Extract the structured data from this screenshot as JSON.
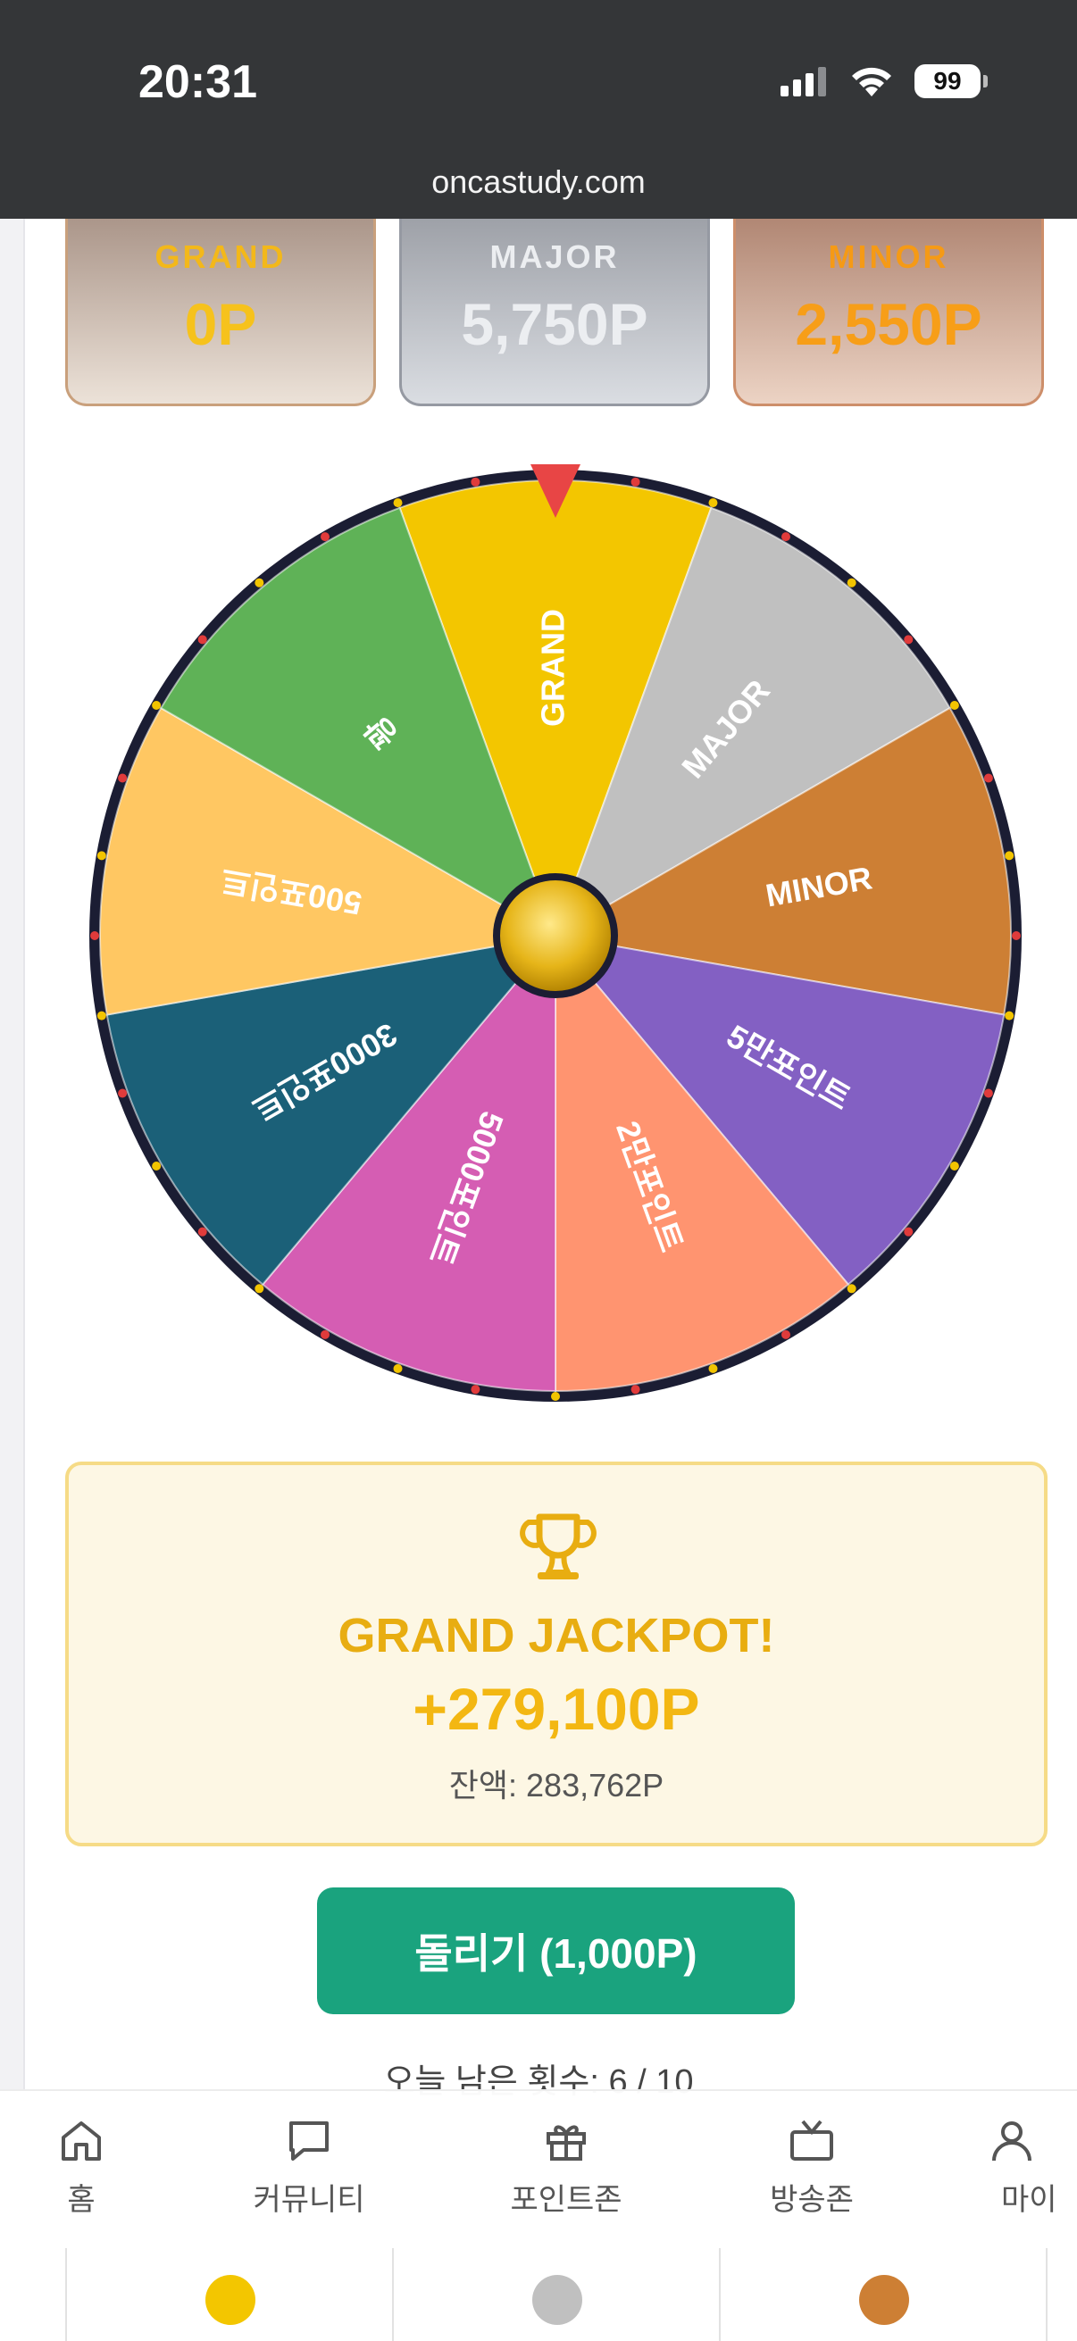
{
  "status_bar": {
    "time": "20:31",
    "battery": "99",
    "url": "oncastudy.com"
  },
  "jackpots": [
    {
      "label": "GRAND",
      "value": "0P",
      "label_color": "#f3b81a",
      "value_color": "#f6c21c"
    },
    {
      "label": "MAJOR",
      "value": "5,750P",
      "label_color": "#eceef1",
      "value_color": "#eceef1"
    },
    {
      "label": "MINOR",
      "value": "2,550P",
      "label_color": "#f59a16",
      "value_color": "#f79e18"
    }
  ],
  "wheel": {
    "segments": [
      {
        "label": "GRAND",
        "color": "#f3c600"
      },
      {
        "label": "MAJOR",
        "color": "#c0c0c0"
      },
      {
        "label": "MINOR",
        "color": "#cd7f34"
      },
      {
        "label": "5만포인트",
        "color": "#8360c3"
      },
      {
        "label": "2만포인트",
        "color": "#ff9470"
      },
      {
        "label": "5000포인트",
        "color": "#d55db3"
      },
      {
        "label": "3000포인트",
        "color": "#1b6078"
      },
      {
        "label": "500포인트",
        "color": "#ffc762"
      },
      {
        "label": "꽝",
        "color": "#5fb257"
      }
    ],
    "rim_color": "#1b1d33",
    "hub_color": "#e6b519",
    "pointer_color": "#e84545"
  },
  "result": {
    "title": "GRAND JACKPOT!",
    "points": "+279,100P",
    "balance": "잔액: 283,762P"
  },
  "spin_button": "돌리기 (1,000P)",
  "remaining": "오늘 남은 횟수: 6 / 10",
  "nav": [
    {
      "label": "홈",
      "icon": "home-icon"
    },
    {
      "label": "커뮤니티",
      "icon": "chat-icon"
    },
    {
      "label": "포인트존",
      "icon": "gift-icon"
    },
    {
      "label": "방송존",
      "icon": "tv-icon"
    },
    {
      "label": "마이",
      "icon": "user-icon"
    }
  ],
  "legend_colors": [
    "#f3c600",
    "#c0c0c0",
    "#cd7f34"
  ]
}
